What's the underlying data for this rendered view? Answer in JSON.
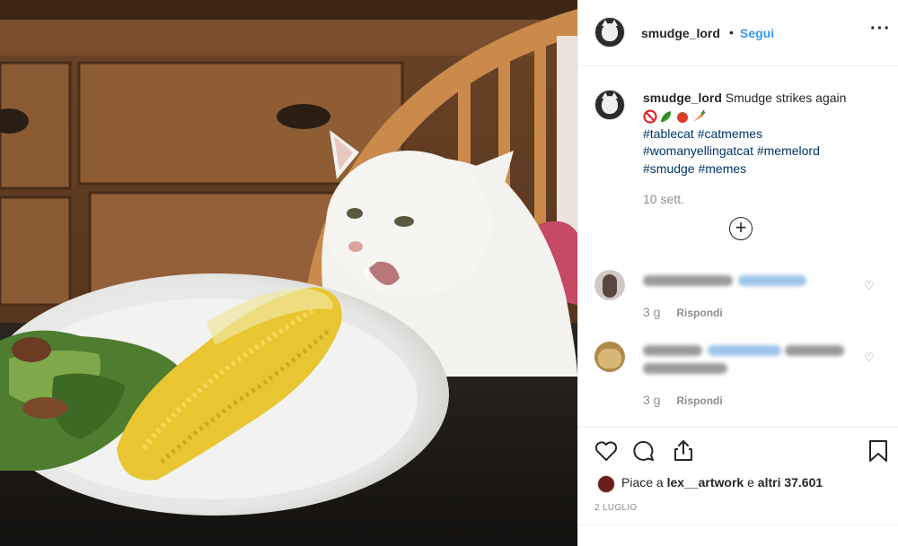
{
  "post": {
    "username": "smudge_lord",
    "separator": "•",
    "follow_label": "Segui",
    "more_label": "···"
  },
  "caption": {
    "username": "smudge_lord",
    "text": "Smudge strikes again",
    "emojis": [
      "no-entry-emoji",
      "leafy-greens-emoji",
      "tomato-emoji",
      "carrot-emoji"
    ],
    "hashtags_line1": "#tablecat #catmemes",
    "hashtags_line2": "#womanyellingatcat #memelord",
    "hashtags_line3": "#smudge #memes",
    "time": "10 sett.",
    "load_more_label": "+"
  },
  "comments": [
    {
      "time": "3 g",
      "reply_label": "Rispondi",
      "heart_icon": "♡"
    },
    {
      "time": "3 g",
      "reply_label": "Rispondi",
      "heart_icon": "♡"
    }
  ],
  "actions": {
    "likes_prefix": "Piace a ",
    "likes_user": "lex__artwork",
    "likes_mid": " e ",
    "likes_others": "altri 37.601",
    "date": "2 LUGLIO"
  },
  "colors": {
    "link": "#3897f0",
    "hashtag": "#003569",
    "secondary_text": "#8e8e8e",
    "primary_text": "#262626",
    "divider": "#efefef"
  }
}
